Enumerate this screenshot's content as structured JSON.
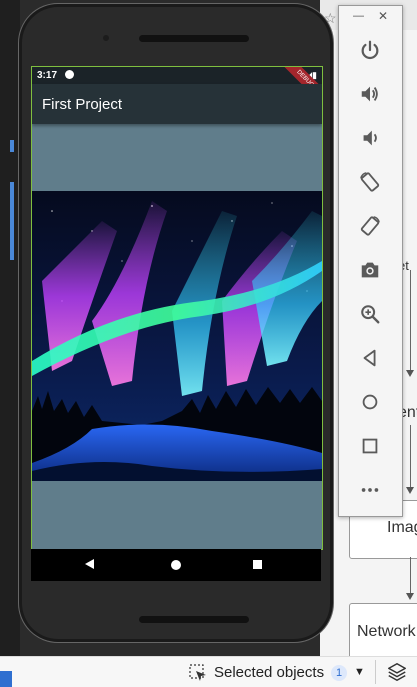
{
  "phone": {
    "time": "3:17",
    "status_icons": "▼◢▮",
    "debug_label": "DEBUG",
    "app_title": "First Project",
    "nav_icons": [
      "back-icon",
      "home-icon",
      "recents-icon"
    ]
  },
  "emulator_panel": {
    "minimize": "—",
    "close": "✕",
    "buttons": [
      "power-icon",
      "volume-up-icon",
      "volume-down-icon",
      "rotate-left-icon",
      "rotate-right-icon",
      "camera-icon",
      "zoom-icon",
      "back-icon",
      "home-icon",
      "overview-icon",
      "more-icon"
    ]
  },
  "background": {
    "fragments": [
      "et",
      "ent",
      "Imag",
      "Network"
    ]
  },
  "status_bar": {
    "selection_label": "Selected objects",
    "selection_count": "1"
  },
  "colors": {
    "appbar": "#263238",
    "screen_bg": "#607d8b",
    "accent": "#2f6fd0"
  }
}
